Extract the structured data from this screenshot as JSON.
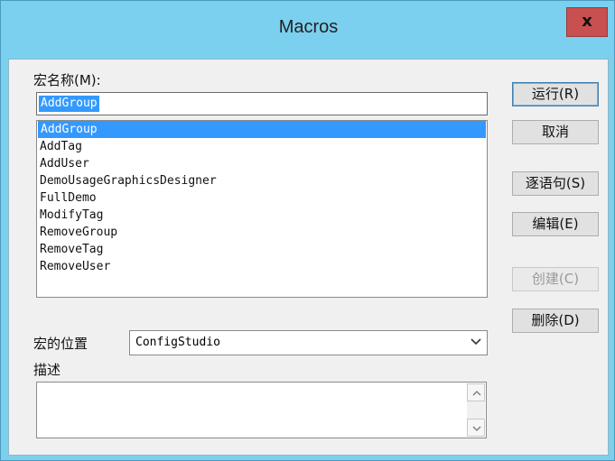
{
  "window": {
    "title": "Macros",
    "close_label": "x"
  },
  "macro_name_label": "宏名称(M):",
  "macro_name_value": "AddGroup",
  "macros": [
    "AddGroup",
    "AddTag",
    "AddUser",
    "DemoUsageGraphicsDesigner",
    "FullDemo",
    "ModifyTag",
    "RemoveGroup",
    "RemoveTag",
    "RemoveUser"
  ],
  "selected_macro_index": 0,
  "buttons": {
    "run": "运行(R)",
    "cancel": "取消",
    "step": "逐语句(S)",
    "edit": "编辑(E)",
    "create": "创建(C)",
    "delete": "删除(D)"
  },
  "location_label": "宏的位置",
  "location_value": "ConfigStudio",
  "description_label": "描述",
  "description_value": "",
  "colors": {
    "titlebar": "#7ad0ee",
    "close": "#c75050",
    "selection": "#3399ff"
  }
}
